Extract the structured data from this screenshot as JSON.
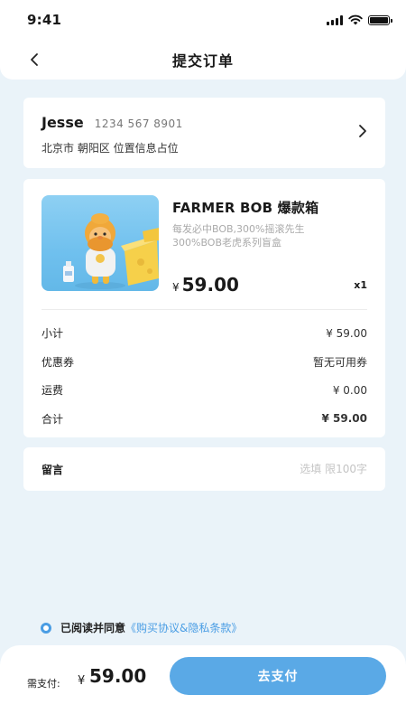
{
  "status_bar": {
    "time": "9:41"
  },
  "nav": {
    "title": "提交订单"
  },
  "address": {
    "name": "Jesse",
    "phone": "1234 567 8901",
    "detail": "北京市 朝阳区 位置信息占位"
  },
  "product": {
    "title": "FARMER BOB 爆款箱",
    "desc_line1": "每发必中BOB,300%摇滚先生",
    "desc_line2": "300%BOB老虎系列盲盒",
    "price_symbol": "¥",
    "price": "59.00",
    "quantity": "x1"
  },
  "summary": [
    {
      "label": "小计",
      "value": "¥ 59.00"
    },
    {
      "label": "优惠券",
      "value": "暂无可用券"
    },
    {
      "label": "运费",
      "value": "¥ 0.00"
    },
    {
      "label": "合计",
      "value": "¥ 59.00"
    }
  ],
  "note": {
    "label": "留言",
    "placeholder": "选填 限100字"
  },
  "agreement": {
    "text": "已阅读并同意",
    "link": "《购买协议&隐私条款》"
  },
  "footer": {
    "pay_label": "需支付:",
    "pay_symbol": "¥",
    "pay_amount": "59.00",
    "pay_button": "去支付"
  },
  "colors": {
    "accent": "#5aa9e6",
    "link": "#4a9de4",
    "background": "#eaf3f9"
  }
}
